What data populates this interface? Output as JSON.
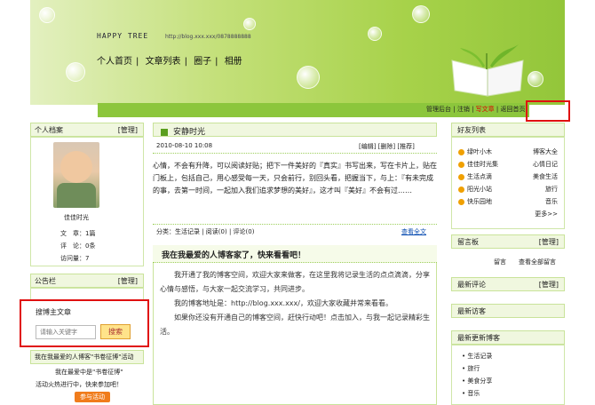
{
  "banner": {
    "brand": "HAPPY TREE",
    "url": "http://blog.xxx.xxx/0878888888",
    "nav": [
      "个人首页",
      "文章列表",
      "圈子",
      "相册"
    ],
    "nav_sep": "|"
  },
  "strip": {
    "items": [
      "管理后台",
      "注销",
      "写文章",
      "返回首页"
    ],
    "sep": "|"
  },
  "left": {
    "profile_header": "个人档案",
    "profile_action": "[管理]",
    "nickname": "佳佳时光",
    "stats": [
      {
        "label": "文　章：",
        "value": "1篇"
      },
      {
        "label": "评　论：",
        "value": "0条"
      },
      {
        "label": "访问量：",
        "value": "7"
      }
    ],
    "notice_header": "公告栏",
    "notice_action": "[管理]",
    "search_header": "搜博主文章",
    "search_placeholder": "请输入关键字",
    "search_button": "搜索",
    "promo_header": "我在我最爱的人博客\"书卷征博\"活动",
    "promo_line1": "我在最爱中是\"书卷征博\"",
    "promo_line2": "活动火热进行中，快来参加吧！",
    "promo_button": "参与活动"
  },
  "post": {
    "title": "安静时光",
    "date": "2010-08-10 10:08",
    "actions": "[编辑] [删除] [推荐]",
    "body": "心情，不会有升降，可以阅读好贴；把下一件美好的『真实』书写出来，写在卡片上，贴在门板上，包括自己，用心感受每一天，只会前行，别回头看，把握当下，与上：『有未完成的事，去第一时间，一起加入我们追求梦想的美好』，这才叫『美好』不会有过……",
    "footer_left": "分类：生活记录 | 阅读(0) | 评论(0)",
    "footer_right": "查看全文"
  },
  "article": {
    "heading": "我在我最爱的人博客家了，快来看看吧！",
    "paragraphs": [
      "我开通了我的博客空间，欢迎大家来做客，在这里我将记录生活的点点滴滴，分享心情与感悟，与大家一起交流学习，共同进步。",
      "我的博客地址是：http://blog.xxx.xxx/，欢迎大家收藏并常来看看。",
      "如果你还没有开通自己的博客空间，赶快行动吧！点击加入，与我一起记录精彩生活。"
    ]
  },
  "right": {
    "friends_header": "好友列表",
    "friends": [
      {
        "name": "绿叶小木",
        "note": "博客大全"
      },
      {
        "name": "佳佳时光集",
        "note": "心情日记"
      },
      {
        "name": "生活点滴",
        "note": "美食生活"
      },
      {
        "name": "阳光小站",
        "note": "旅行"
      },
      {
        "name": "快乐园地",
        "note": "音乐"
      }
    ],
    "friends_more": "更多>>",
    "msg_header": "留言板",
    "msg_action": "[管理]",
    "msg_line": "留言　　查看全部留言",
    "recent_comments_header": "最新评论",
    "recent_comments_action": "[管理]",
    "recent_visitors_header": "最新访客",
    "recent_posts_header": "最新更新博客",
    "recent_posts": [
      "生活记录",
      "旅行",
      "美食分享",
      "音乐"
    ]
  },
  "colors": {
    "accent": "#8cc63c",
    "highlight": "#e01010",
    "link": "#0a4db1"
  }
}
